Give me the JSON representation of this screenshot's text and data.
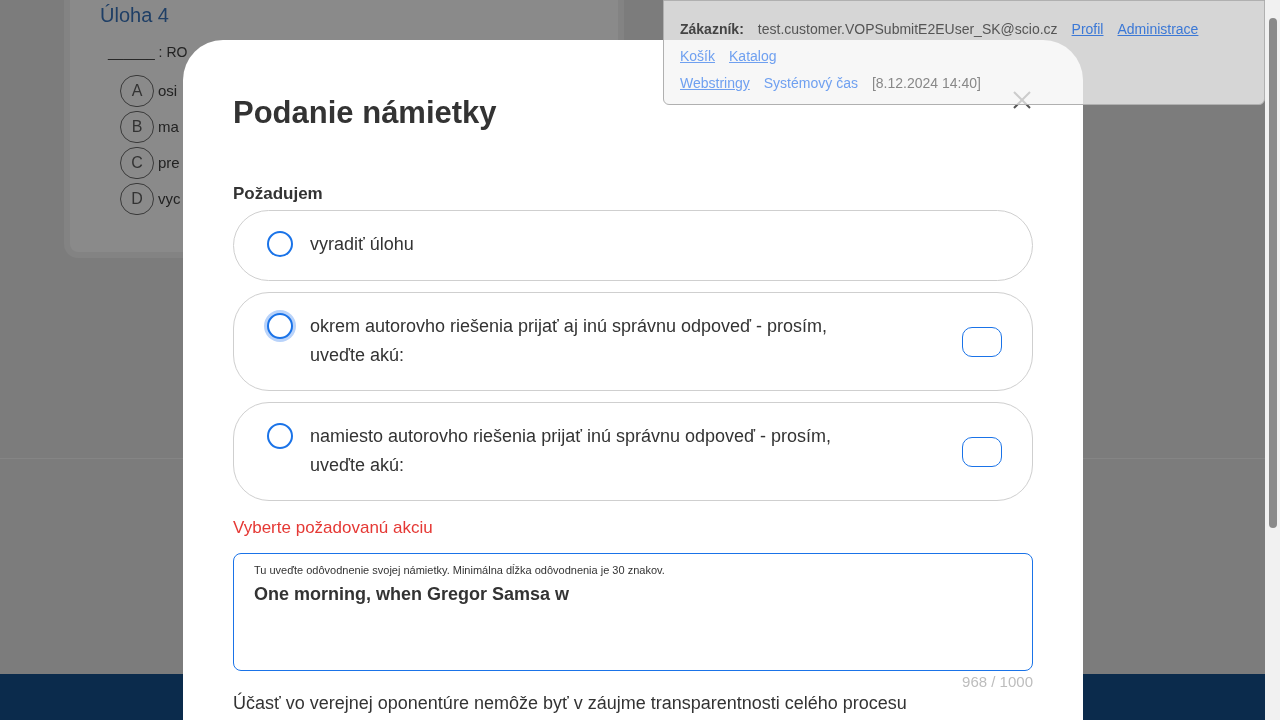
{
  "background": {
    "task_title": "Úloha 4",
    "prompt": "______ : RO",
    "options": [
      {
        "letter": "A",
        "text": "osi"
      },
      {
        "letter": "B",
        "text": "ma"
      },
      {
        "letter": "C",
        "text": "pre"
      },
      {
        "letter": "D",
        "text": "vyc"
      }
    ]
  },
  "modal": {
    "title": "Podanie námietky",
    "section_label": "Požadujem",
    "choices": [
      {
        "label": "vyradiť úlohu",
        "selected": false,
        "focused": false,
        "has_input": false
      },
      {
        "label": "okrem autorovho riešenia prijať aj inú správnu odpoveď - prosím, uveďte akú:",
        "selected": false,
        "focused": true,
        "has_input": true
      },
      {
        "label": "namiesto autorovho riešenia prijať inú správnu odpoveď - prosím, uveďte akú:",
        "selected": false,
        "focused": false,
        "has_input": true
      }
    ],
    "error": "Vyberte požadovanú akciu",
    "justification": {
      "label": "Tu uveďte odôvodnenie svojej námietky. Minimálna dĺžka odôvodnenia je 30 znakov.",
      "value": "One morning, when Gregor Samsa w",
      "counter": "968 / 1000"
    },
    "footer_text": "Účasť vo verejnej oponentúre nemôže byť v záujme transparentnosti celého procesu"
  },
  "debug_panel": {
    "customer_label": "Zákazník:",
    "customer": "test.customer.VOPSubmitE2EUser_SK@scio.cz",
    "links_row1": [
      "Profil",
      "Administrace"
    ],
    "links_row2": [
      "Košík",
      "Katalog"
    ],
    "links_row3": [
      "Webstringy",
      "Systémový čas"
    ],
    "time": "[8.12.2024 14:40]"
  }
}
